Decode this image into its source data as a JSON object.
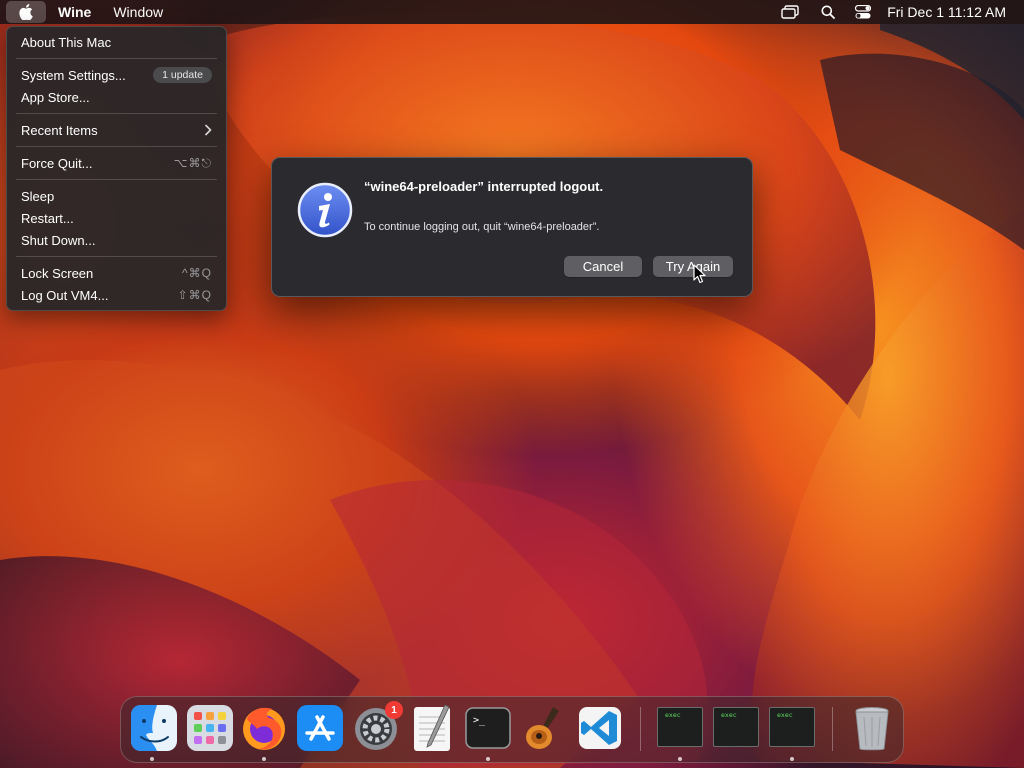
{
  "menubar": {
    "app_name": "Wine",
    "menus": [
      "Window"
    ],
    "clock": "Fri Dec 1  11:12 AM",
    "status_icons": [
      "screen-mirroring-icon",
      "search-icon",
      "control-center-icon"
    ]
  },
  "apple_menu": {
    "about": "About This Mac",
    "system_settings": "System Settings...",
    "system_settings_badge": "1 update",
    "app_store": "App Store...",
    "recent_items": "Recent Items",
    "force_quit": "Force Quit...",
    "force_quit_shortcut": "⌥⌘⎋",
    "sleep": "Sleep",
    "restart": "Restart...",
    "shut_down": "Shut Down...",
    "lock_screen": "Lock Screen",
    "lock_screen_shortcut": "^⌘Q",
    "log_out": "Log Out VM4...",
    "log_out_shortcut": "⇧⌘Q"
  },
  "alert": {
    "title": "“wine64-preloader” interrupted logout.",
    "message": "To continue logging out, quit “wine64-preloader”.",
    "cancel_label": "Cancel",
    "try_again_label": "Try Again",
    "icon": "info-icon"
  },
  "dock": {
    "apps": [
      "finder",
      "launchpad",
      "firefox",
      "app-store",
      "system-settings",
      "textedit",
      "terminal",
      "garageband",
      "vscode"
    ],
    "system_settings_badge": "1",
    "windows": [
      {
        "label": "exec"
      },
      {
        "label": "exec"
      },
      {
        "label": "exec"
      }
    ],
    "trash": "trash"
  },
  "colors": {
    "menu_bg": "#2a2628",
    "alert_bg": "#2b2a2e",
    "button_bg": "#5f5e62",
    "badge_red": "#ef3b33",
    "info_blue": "#3f6ee0"
  }
}
